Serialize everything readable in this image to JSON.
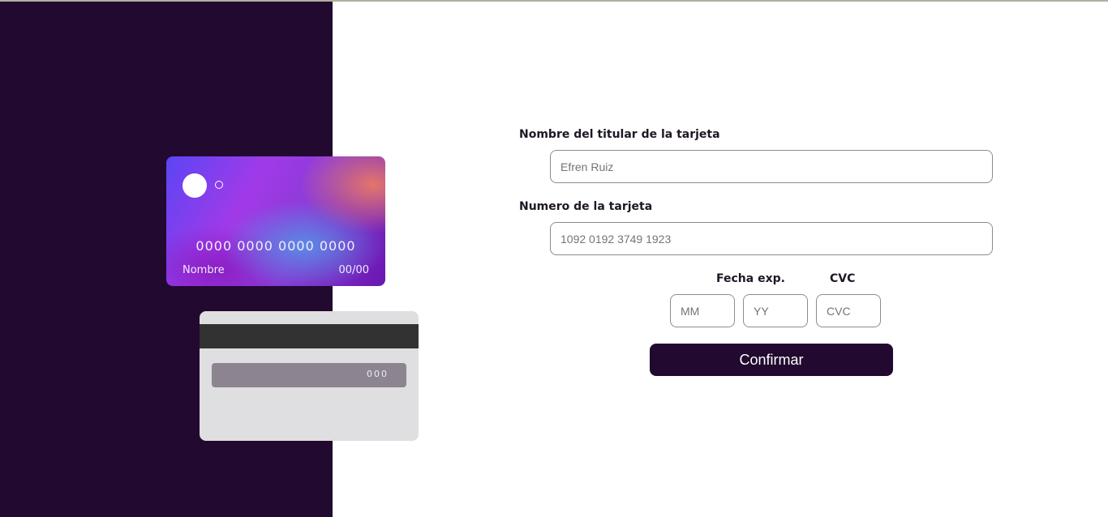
{
  "card_front": {
    "number": "0000 0000 0000 0000",
    "name": "Nombre",
    "expiry": "00/00"
  },
  "card_back": {
    "cvc": "000"
  },
  "form": {
    "holder_label": "Nombre del titular de la tarjeta",
    "holder_placeholder": "Efren Ruiz",
    "number_label": "Numero de la tarjeta",
    "number_placeholder": "1092 0192 3749 1923",
    "exp_label": "Fecha exp.",
    "mm_placeholder": "MM",
    "yy_placeholder": "YY",
    "cvc_label": "CVC",
    "cvc_placeholder": "CVC",
    "confirm_label": "Confirmar"
  },
  "colors": {
    "panel": "#21092f",
    "button": "#21092f",
    "card_back": "#dfdee1",
    "stripe": "#323232"
  }
}
